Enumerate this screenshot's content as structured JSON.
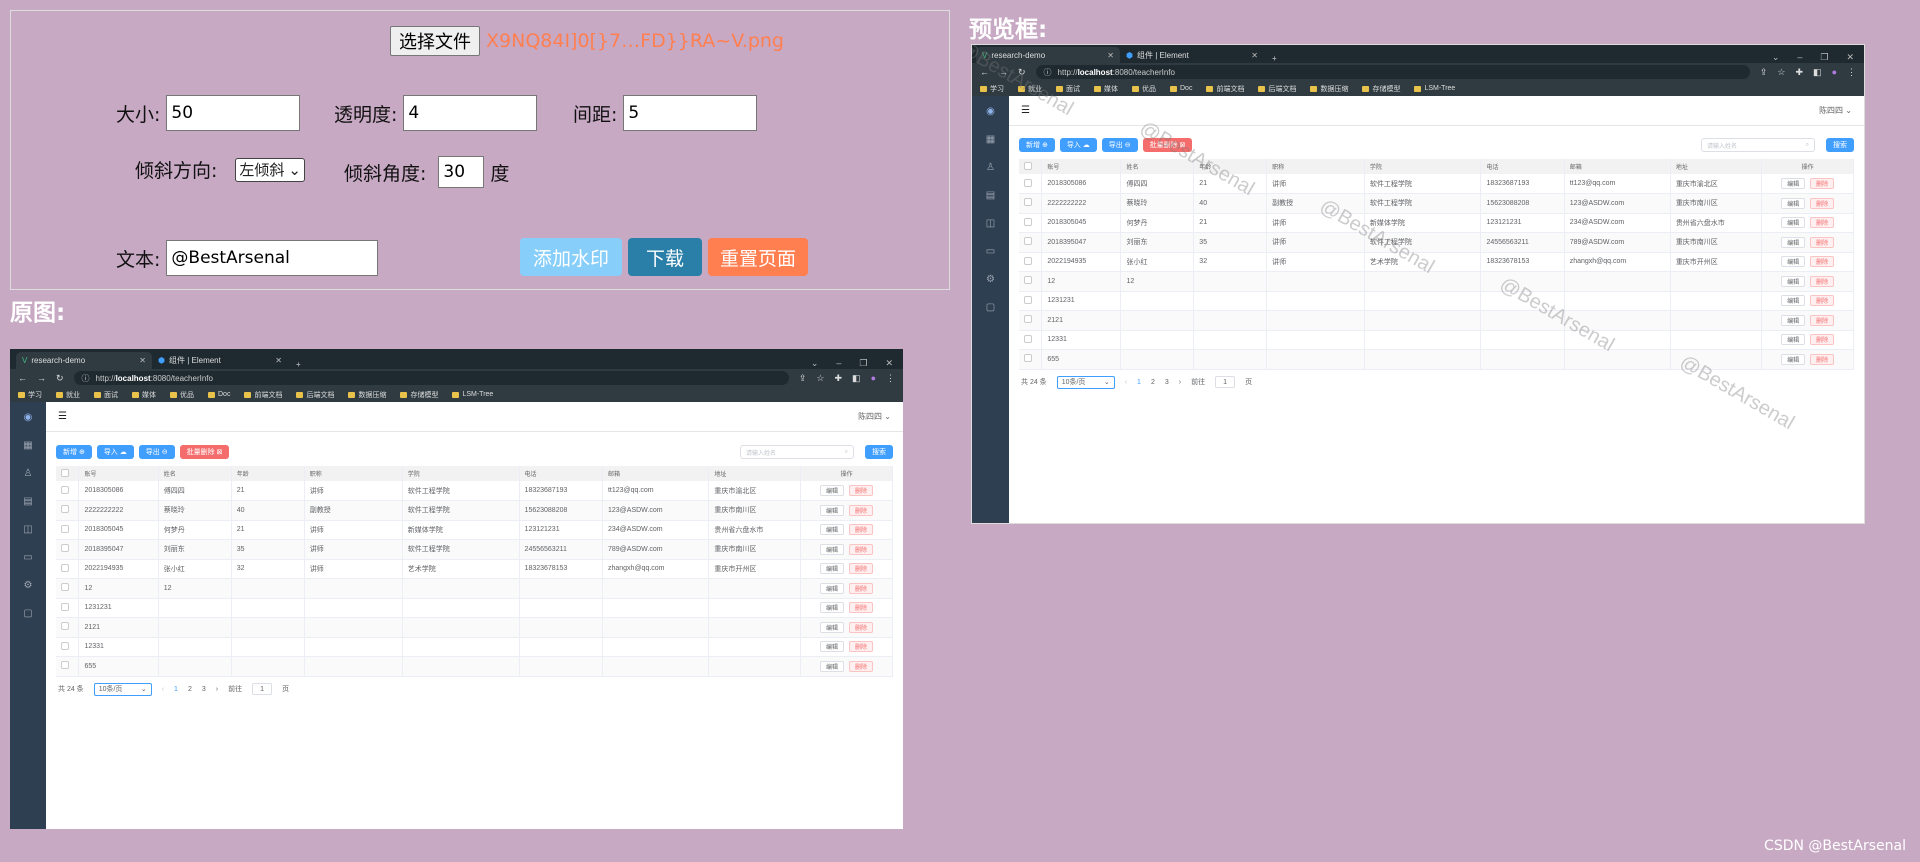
{
  "controls": {
    "file_button": "选择文件",
    "file_name": "X9NQ84I]0[}7…FD}}RA~V.png",
    "size_label": "大小:",
    "size_value": "50",
    "opacity_label": "透明度:",
    "opacity_value": "4",
    "spacing_label": "间距:",
    "spacing_value": "5",
    "tilt_dir_label": "倾斜方向:",
    "tilt_dir_value": "左倾斜",
    "tilt_angle_label": "倾斜角度:",
    "tilt_angle_value": "30",
    "degree_unit": "度",
    "text_label": "文本:",
    "text_value": "@BestArsenal",
    "add_watermark": "添加水印",
    "download": "下载",
    "reset": "重置页面"
  },
  "section_original": "原图:",
  "section_preview": "预览框:",
  "watermark_text": "@BestArsenal",
  "footer": "CSDN @BestArsenal",
  "colors": {
    "background": "#c8a9c4",
    "file_name": "#ff7f50",
    "add_btn": "#87cefa",
    "download_btn": "#2a7fa8",
    "reset_btn": "#ff7f50"
  },
  "app": {
    "tab1": "research-demo",
    "tab2": "组件 | Element",
    "url_prefix": "http://",
    "url_host": "localhost",
    "url_rest": ":8080/teacherInfo",
    "bookmarks": [
      "学习",
      "就业",
      "面试",
      "媒体",
      "优品",
      "Doc",
      "前端文档",
      "后端文档",
      "数据压缩",
      "存储模型",
      "LSM-Tree"
    ],
    "user": "陈四四",
    "buttons": {
      "add": "新增",
      "import": "导入",
      "export": "导出",
      "batch_delete": "批量删除"
    },
    "search_placeholder": "请输入姓名",
    "search_button": "搜索",
    "columns": [
      "账号",
      "姓名",
      "年龄",
      "职称",
      "学院",
      "电话",
      "邮箱",
      "地址",
      "操作"
    ],
    "rows": [
      [
        "2018305086",
        "傅四四",
        "21",
        "讲师",
        "软件工程学院",
        "18323687193",
        "tt123@qq.com",
        "重庆市渝北区"
      ],
      [
        "2222222222",
        "蔡晓玲",
        "40",
        "副教授",
        "软件工程学院",
        "15623088208",
        "123@ASDW.com",
        "重庆市南川区"
      ],
      [
        "2018305045",
        "何梦丹",
        "21",
        "讲师",
        "新媒体学院",
        "123121231",
        "234@ASDW.com",
        "贵州省六盘水市"
      ],
      [
        "2018395047",
        "刘丽东",
        "35",
        "讲师",
        "软件工程学院",
        "24556563211",
        "789@ASDW.com",
        "重庆市南川区"
      ],
      [
        "2022194935",
        "张小红",
        "32",
        "讲师",
        "艺术学院",
        "18323678153",
        "zhangxh@qq.com",
        "重庆市开州区"
      ],
      [
        "12",
        "12",
        "",
        "",
        "",
        "",
        "",
        ""
      ],
      [
        "1231231",
        "",
        "",
        "",
        "",
        "",
        "",
        ""
      ],
      [
        "2121",
        "",
        "",
        "",
        "",
        "",
        "",
        ""
      ],
      [
        "12331",
        "",
        "",
        "",
        "",
        "",
        "",
        ""
      ],
      [
        "655",
        "",
        "",
        "",
        "",
        "",
        "",
        ""
      ]
    ],
    "edit": "编辑",
    "delete": "删除",
    "total": "共 24 条",
    "page_size": "10条/页",
    "pages": [
      "1",
      "2",
      "3"
    ],
    "goto": "前往",
    "page_unit": "页",
    "goto_value": "1"
  }
}
